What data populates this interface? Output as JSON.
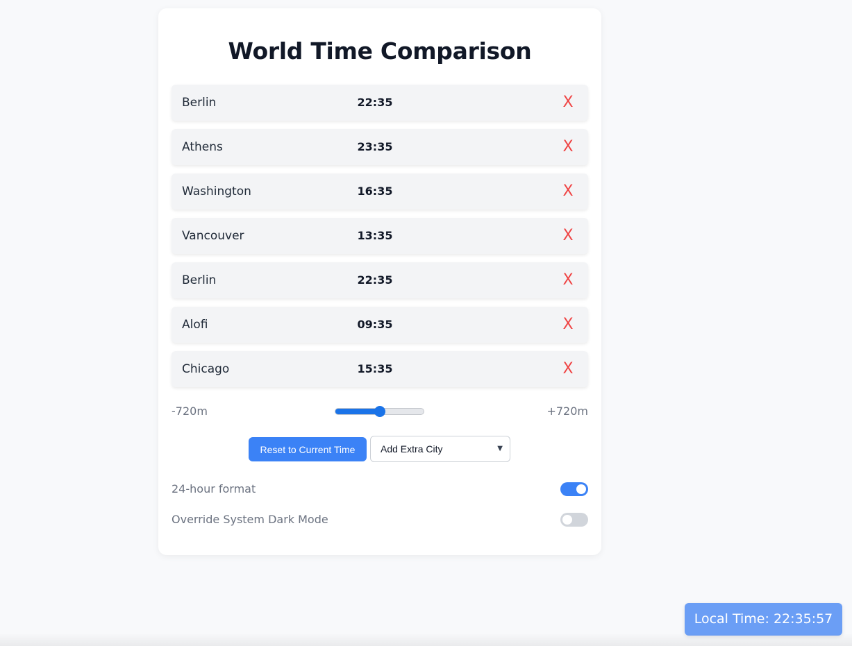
{
  "app": {
    "title": "World Time Comparison"
  },
  "cities": [
    {
      "name": "Berlin",
      "time": "22:35",
      "remove_label": "X"
    },
    {
      "name": "Athens",
      "time": "23:35",
      "remove_label": "X"
    },
    {
      "name": "Washington",
      "time": "16:35",
      "remove_label": "X"
    },
    {
      "name": "Vancouver",
      "time": "13:35",
      "remove_label": "X"
    },
    {
      "name": "Berlin",
      "time": "22:35",
      "remove_label": "X"
    },
    {
      "name": "Alofi",
      "time": "09:35",
      "remove_label": "X"
    },
    {
      "name": "Chicago",
      "time": "15:35",
      "remove_label": "X"
    }
  ],
  "offset_slider": {
    "min_label": "-720m",
    "max_label": "+720m",
    "min": -720,
    "max": 720,
    "value": 0
  },
  "actions": {
    "reset_label": "Reset to Current Time",
    "add_city_selected": "Add Extra City"
  },
  "settings": {
    "format_label": "24-hour format",
    "format_on": true,
    "dark_label": "Override System Dark Mode",
    "dark_on": false
  },
  "local_time": {
    "label": "Local Time: 22:35:57"
  },
  "colors": {
    "accent": "#3b82f6",
    "remove": "#ef4444",
    "local_time_bg": "#6b9ef5"
  },
  "icons": {
    "select_chevron": "chevron-down-icon"
  }
}
